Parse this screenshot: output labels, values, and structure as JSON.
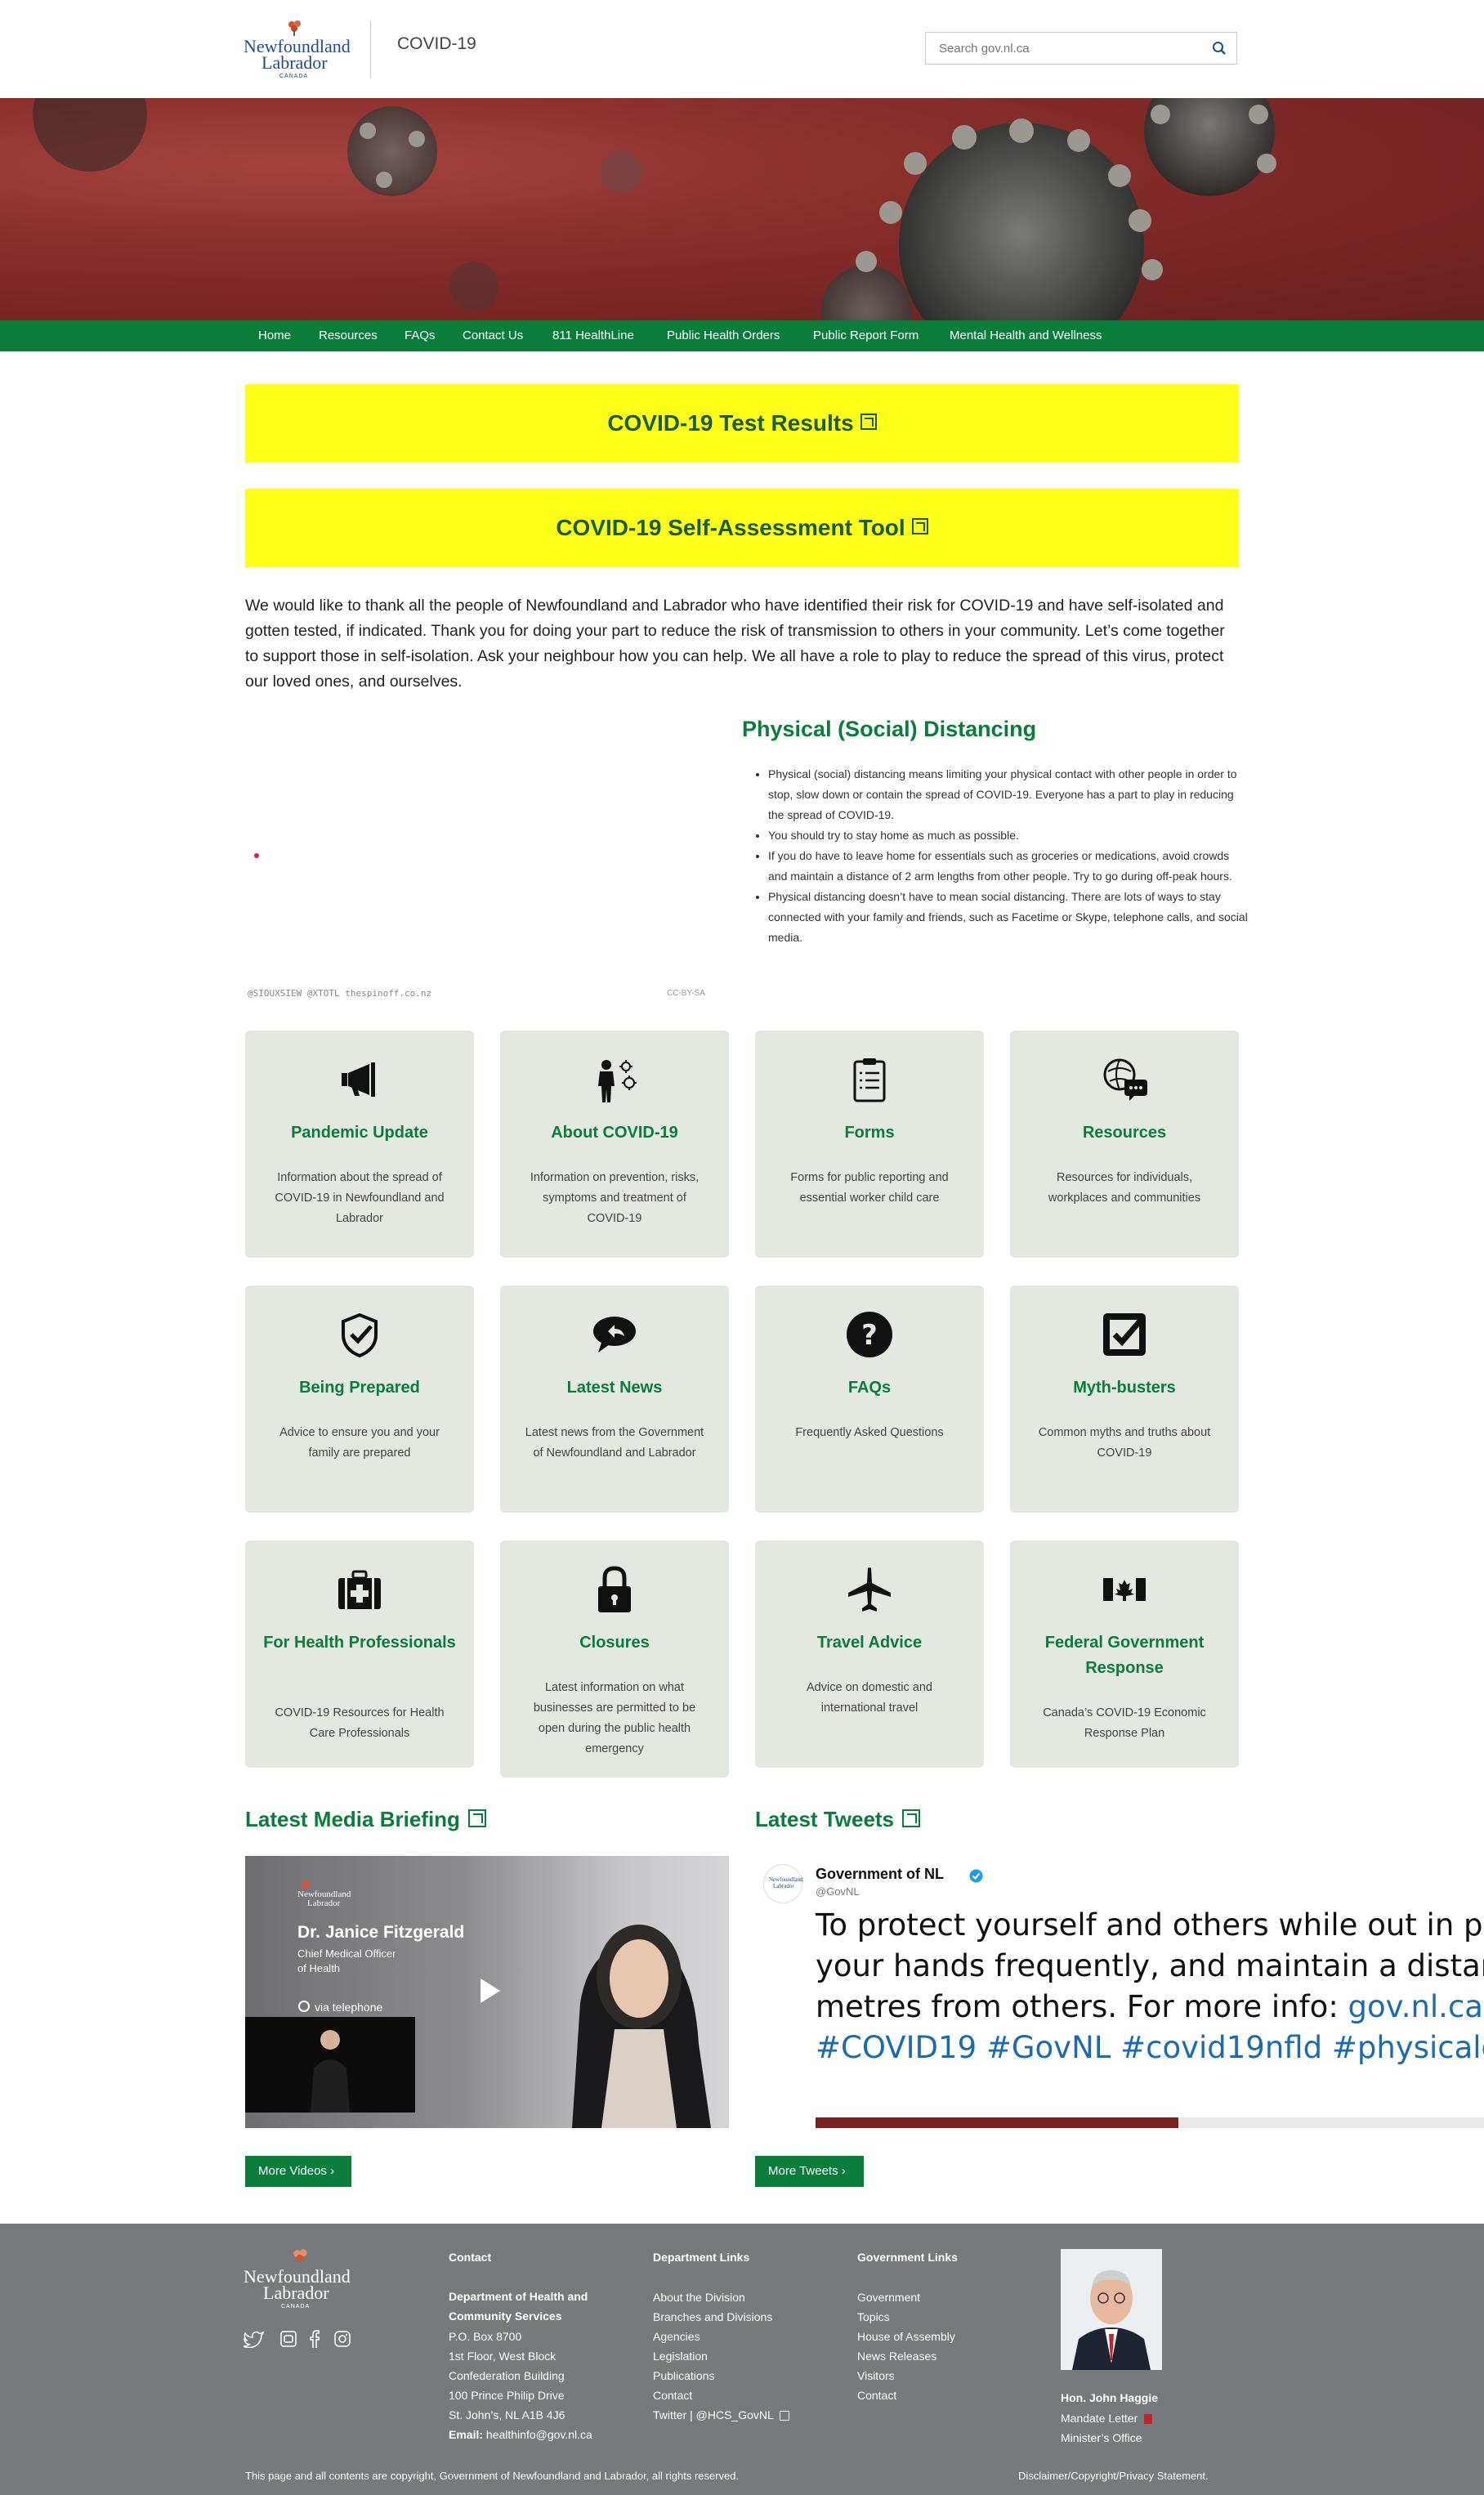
{
  "header": {
    "logo_line1": "Newfoundland",
    "logo_line2": "Labrador",
    "logo_line3": "CANADA",
    "site_title": "COVID-19",
    "search_placeholder": "Search gov.nl.ca"
  },
  "nav": {
    "items": [
      "Home",
      "Resources",
      "FAQs",
      "Contact Us",
      "811 HealthLine",
      "Public Health Orders",
      "Public Report Form",
      "Mental Health and Wellness"
    ]
  },
  "buttons": {
    "test_results": "COVID-19 Test Results",
    "self_assessment": "COVID-19 Self-Assessment Tool"
  },
  "intro": "We would like to thank all the people of Newfoundland and Labrador who have identified their risk for COVID-19 and have self-isolated and gotten tested, if indicated. Thank you for doing your part to reduce the risk of transmission to others in your community. Let’s come together to support those in self-isolation. Ask your neighbour how you can help. We all have a role to play to reduce the spread of this virus, protect our loved ones, and ourselves.",
  "distancing": {
    "title": "Physical (Social) Distancing",
    "bullets": [
      "Physical (social) distancing means limiting your physical contact with other people in order to stop, slow down or contain the spread of COVID-19. Everyone has a part to play in reducing the spread of COVID-19.",
      "You should try to stay home as much as possible.",
      "If you do have to leave home for essentials such as groceries or medications, avoid crowds and maintain a distance of 2 arm lengths from other people. Try to go during off-peak hours.",
      "Physical distancing doesn’t have to mean social distancing. There are lots of ways to stay connected with your family and friends, such as Facetime or Skype, telephone calls, and social media."
    ],
    "graphic_credit": "@SIOUXSIEW @XTOTL thespinoff.co.nz",
    "graphic_license": "CC-BY-SA"
  },
  "cards": [
    {
      "icon": "megaphone-icon",
      "title": "Pandemic Update",
      "desc": "Information about the spread of COVID-19 in Newfoundland and Labrador"
    },
    {
      "icon": "person-virus-icon",
      "title": "About COVID-19",
      "desc": "Information on prevention, risks, symptoms and treatment of COVID-19"
    },
    {
      "icon": "clipboard-icon",
      "title": "Forms",
      "desc": "Forms for public reporting and essential worker child care"
    },
    {
      "icon": "globe-chat-icon",
      "title": "Resources",
      "desc": "Resources for individuals, workplaces and communities"
    },
    {
      "icon": "shield-check-icon",
      "title": "Being Prepared",
      "desc": "Advice to ensure you and your family are prepared"
    },
    {
      "icon": "reply-bubble-icon",
      "title": "Latest News",
      "desc": "Latest news from the Government of Newfoundland and Labrador"
    },
    {
      "icon": "question-circle-icon",
      "title": "FAQs",
      "desc": "Frequently Asked Questions"
    },
    {
      "icon": "checkbox-icon",
      "title": "Myth-busters",
      "desc": "Common myths and truths about COVID-19"
    },
    {
      "icon": "medical-kit-icon",
      "title": "For Health Professionals",
      "desc": "COVID-19 Resources for Health Care Professionals"
    },
    {
      "icon": "lock-icon",
      "title": "Closures",
      "desc": "Latest information on what businesses are permitted to be open during the public health emergency"
    },
    {
      "icon": "airplane-icon",
      "title": "Travel Advice",
      "desc": "Advice on domestic and international travel"
    },
    {
      "icon": "canada-flag-icon",
      "title": "Federal Government Response",
      "desc": "Canada’s COVID-19 Economic Response Plan"
    }
  ],
  "media": {
    "title": "Latest Media Briefing",
    "video_name": "Dr. Janice Fitzgerald",
    "video_role1": "Chief Medical Officer",
    "video_role2": "of Health",
    "video_via": "via telephone",
    "more_label": "More Videos ›"
  },
  "tweets": {
    "title": "Latest Tweets",
    "account_name": "Government of NL",
    "handle": "@GovNL",
    "text_line1": "To protect yourself and others while out in p",
    "text_line2": "your hands frequently, and maintain a distan",
    "text_line3_pre": "metres from others. For more info: ",
    "text_line3_link": "gov.nl.ca",
    "text_line4": "#COVID19 #GovNL #covid19nfld #physicald",
    "more_label": "More Tweets ›"
  },
  "footer": {
    "contact": {
      "heading": "Contact",
      "org_line1": "Department of Health and",
      "org_line2": "Community Services",
      "lines": [
        "P.O. Box 8700",
        "1st Floor, West Block",
        "Confederation Building",
        "100 Prince Philip Drive",
        "St. John’s, NL A1B 4J6"
      ],
      "email_label": "Email:",
      "email": "healthinfo@gov.nl.ca"
    },
    "dept_links": {
      "heading": "Department Links",
      "items": [
        "About the Division",
        "Branches and Divisions",
        "Agencies",
        "Legislation",
        "Publications",
        "Contact",
        "Twitter | @HCS_GovNL"
      ]
    },
    "gov_links": {
      "heading": "Government Links",
      "items": [
        "Government",
        "Topics",
        "House of Assembly",
        "News Releases",
        "Visitors",
        "Contact"
      ]
    },
    "minister": {
      "name": "Hon. John Haggie",
      "mandate": "Mandate Letter",
      "office": "Minister’s Office"
    },
    "copyright": "This page and all contents are copyright, Government of Newfoundland and Labrador, all rights reserved.",
    "disclaimer": "Disclaimer/Copyright/Privacy Statement."
  },
  "colors": {
    "green": "#0b7d3a",
    "yellow": "#ffff1a",
    "card_bg": "#e3e9e1",
    "footer_bg": "#777a7d"
  }
}
